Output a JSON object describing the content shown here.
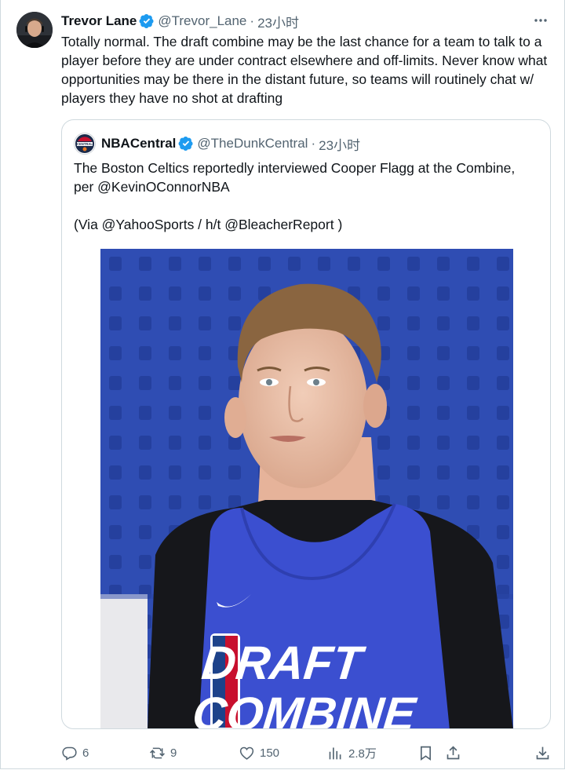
{
  "tweet": {
    "author": {
      "name": "Trevor Lane",
      "handle": "@Trevor_Lane",
      "time": "23小时"
    },
    "text": "Totally normal. The draft combine may be the last chance for a team to talk to a player before they are under contract elsewhere and off-limits. Never know what opportunities may be there in the distant future, so teams will routinely chat w/ players they have no shot at drafting"
  },
  "quoted": {
    "author": {
      "name": "NBACentral",
      "handle": "@TheDunkCentral",
      "time": "23小时",
      "avatar_text": "CENTRAL"
    },
    "line1": "The Boston Celtics reportedly interviewed Cooper Flagg at the Combine, per @KevinOConnorNBA",
    "line2": "(Via @YahooSports / h/t @BleacherReport )",
    "image": {
      "jersey_line1": "DRAFT",
      "jersey_line2": "COMBINE"
    }
  },
  "actions": {
    "replies": "6",
    "reposts": "9",
    "likes": "150",
    "views": "2.8万"
  },
  "colors": {
    "text": "#0f1419",
    "secondary": "#536471",
    "verified": "#1d9bf0",
    "border": "#cfd9de",
    "photo_bg": "#2f4db3",
    "jersey": "#3b4fd0"
  },
  "icons": [
    "verified-badge-icon",
    "more-icon",
    "reply-icon",
    "repost-icon",
    "like-icon",
    "views-icon",
    "bookmark-icon",
    "share-icon",
    "download-icon"
  ]
}
